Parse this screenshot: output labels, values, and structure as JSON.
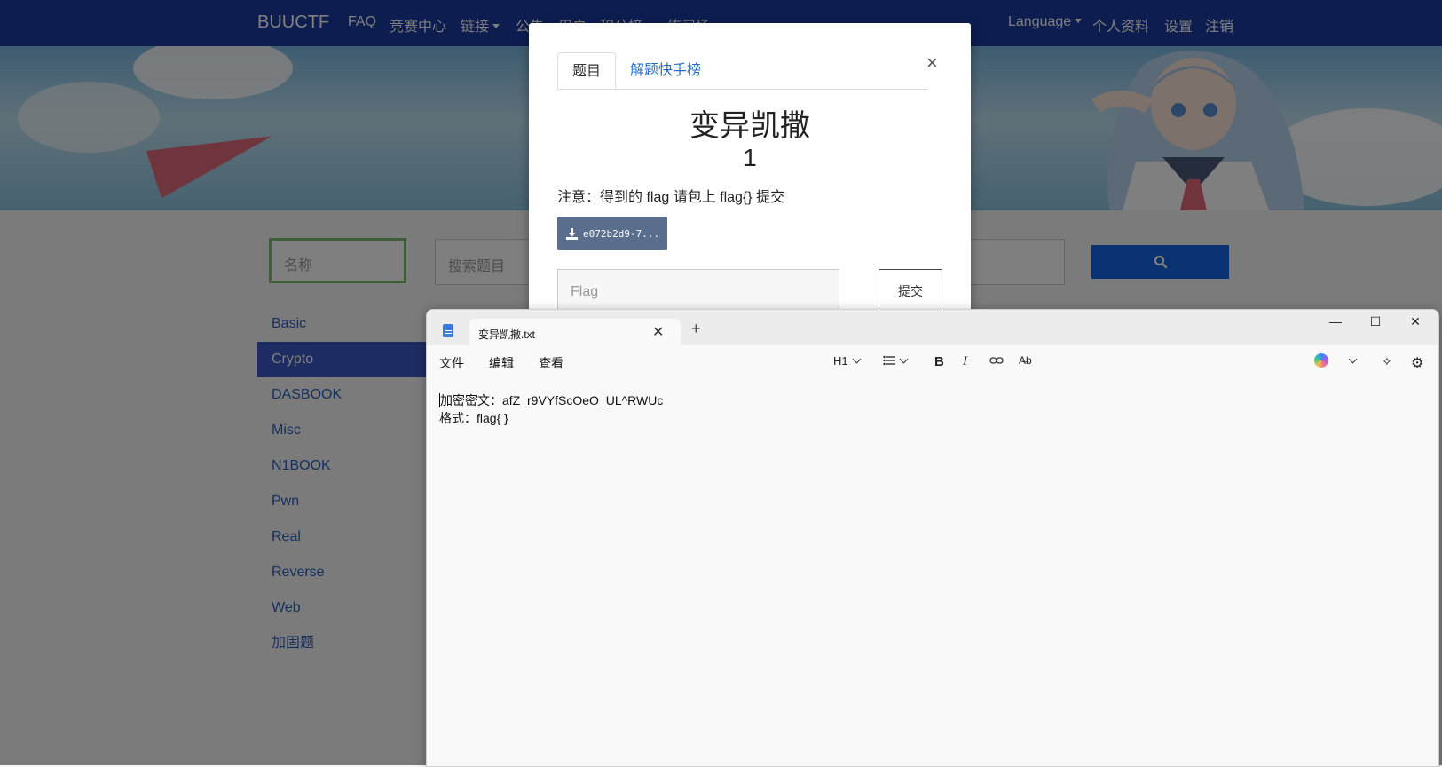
{
  "nav": {
    "brand": "BUUCTF",
    "links": [
      "FAQ",
      "竞赛中心",
      "链接",
      "公告",
      "用户",
      "积分榜",
      "练习场"
    ],
    "right_links": [
      "Language",
      "个人资料",
      "设置",
      "注销"
    ]
  },
  "filters": {
    "name_placeholder": "名称",
    "search_placeholder": "搜索题目"
  },
  "categories": [
    "Basic",
    "Crypto",
    "DASBOOK",
    "Misc",
    "N1BOOK",
    "Pwn",
    "Real",
    "Reverse",
    "Web",
    "加固题"
  ],
  "active_category": "Crypto",
  "modal": {
    "tabs": [
      "题目",
      "解题快手榜"
    ],
    "title": "变异凯撒",
    "value": "1",
    "note": "注意：得到的 flag 请包上 flag{} 提交",
    "download_label": "e072b2d9-7...",
    "flag_placeholder": "Flag",
    "submit_label": "提交"
  },
  "notepad": {
    "tab_title": "变异凯撒.txt",
    "menus": [
      "文件",
      "编辑",
      "查看"
    ],
    "heading_tool": "H1",
    "lines": [
      "加密密文：afZ_r9VYfScOeO_UL^RWUc",
      "格式：flag{ }"
    ]
  }
}
